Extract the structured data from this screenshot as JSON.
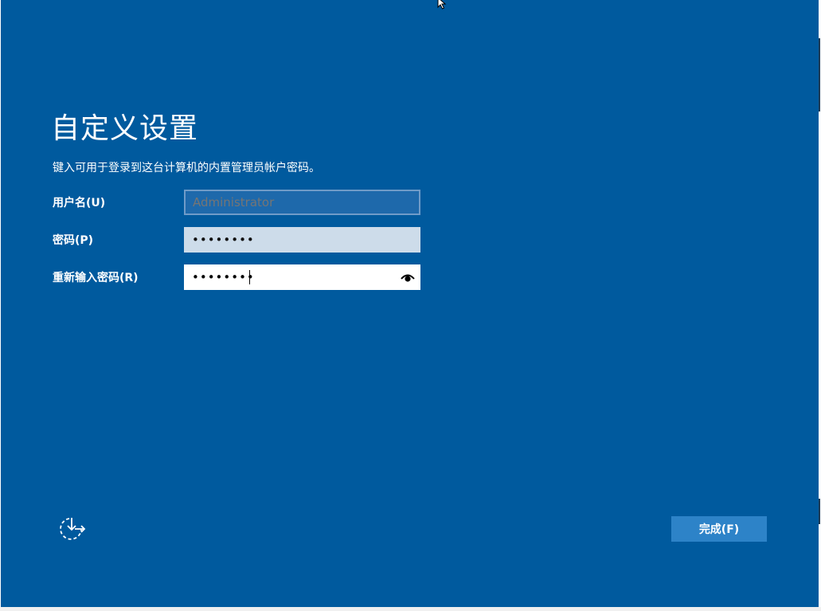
{
  "page": {
    "title": "自定义设置",
    "subtitle": "键入可用于登录到这台计算机的内置管理员帐户密码。"
  },
  "fields": {
    "username": {
      "label": "用户名(U)",
      "placeholder": "Administrator",
      "value": ""
    },
    "password": {
      "label": "密码(P)",
      "value": "••••••••"
    },
    "confirm_password": {
      "label": "重新输入密码(R)",
      "value": "••••••••"
    }
  },
  "buttons": {
    "finish_label": "完成(F)"
  },
  "icons": {
    "ease_of_access": "ease-of-access-icon",
    "reveal_password": "eye-icon",
    "mouse_pointer": "cursor-icon"
  },
  "colors": {
    "background": "#005a9e",
    "button": "#2d83c8",
    "text": "#ffffff"
  }
}
